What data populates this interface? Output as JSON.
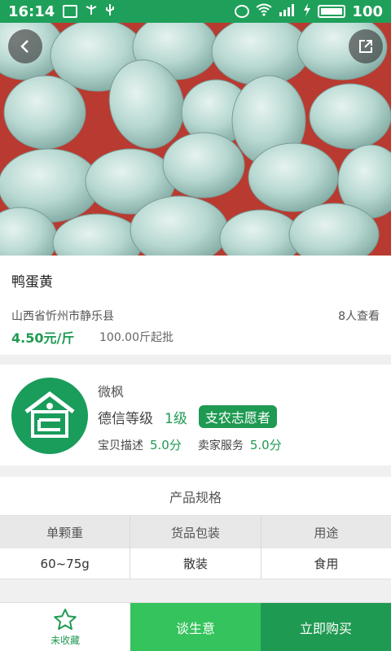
{
  "status_bar": {
    "time": "16:14",
    "battery_level": "100"
  },
  "hero": {
    "back_icon": "chevron-left-icon",
    "share_icon": "external-link-icon"
  },
  "product": {
    "name": "鸭蛋黄",
    "location": "山西省忻州市静乐县",
    "views": "8人查看",
    "price": "4.50元/斤",
    "min_order": "100.00斤起批"
  },
  "seller": {
    "name": "微枫",
    "credit_label": "德信等级",
    "credit_level": "1级",
    "badge": "支农志愿者",
    "desc_label": "宝贝描述",
    "desc_score": "5.0分",
    "service_label": "卖家服务",
    "service_score": "5.0分"
  },
  "specs": {
    "title": "产品规格",
    "headers": [
      "单颗重",
      "货品包装",
      "用途"
    ],
    "values": [
      "60~75g",
      "散装",
      "食用"
    ]
  },
  "bottom": {
    "fav_label": "未收藏",
    "talk_label": "谈生意",
    "buy_label": "立即购买"
  },
  "colors": {
    "brand_green": "#1f9a52",
    "light_green": "#35c35d",
    "status_bar": "#1fa05a"
  }
}
